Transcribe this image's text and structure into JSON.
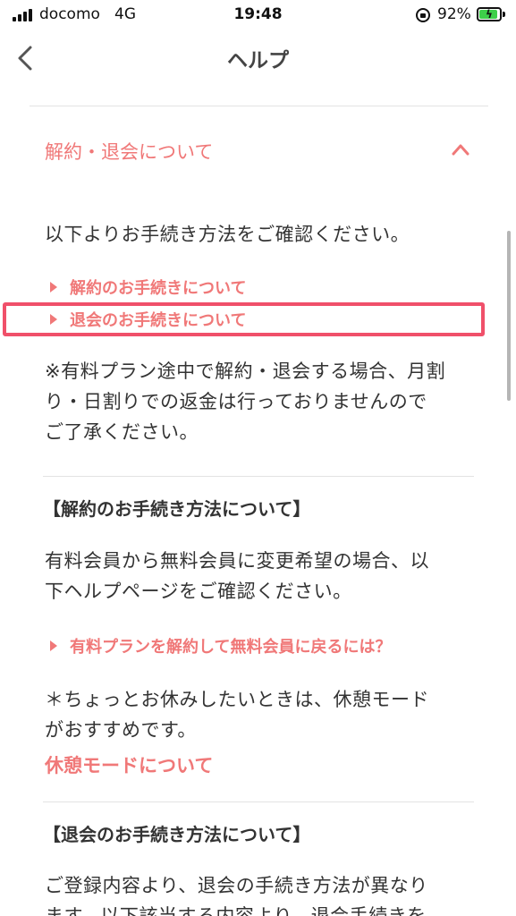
{
  "status_bar": {
    "carrier": "docomo",
    "network": "4G",
    "time": "19:48",
    "battery_percent": "92%",
    "battery_level": 0.92,
    "battery_color": "#3ecf4a"
  },
  "nav": {
    "title": "ヘルプ",
    "back_icon": "chevron-left-icon"
  },
  "accordion": {
    "title": "解約・退会について",
    "expanded": true,
    "toggle_icon": "chevron-up-icon",
    "intro": "以下よりお手続き方法をご確認ください。",
    "links": [
      "解約のお手続きについて",
      "退会のお手続きについて"
    ],
    "note_lines": [
      "※有料プラン途中で解約・退会する場合、月割",
      "り・日割りでの返金は行っておりませんので",
      "ご了承ください。"
    ]
  },
  "cancel_section": {
    "heading": "【解約のお手続き方法について】",
    "body_lines": [
      "有料会員から無料会員に変更希望の場合、以",
      "下ヘルプページをご確認ください。"
    ],
    "link": "有料プランを解約して無料会員に戻るには？",
    "tip_lines": [
      "＊ちょっとお休みしたいときは、休憩モード",
      "がおすすめです。"
    ],
    "rest_link": "休憩モードについて"
  },
  "withdraw_section": {
    "heading": "【退会のお手続き方法について】",
    "body_lines": [
      "ご登録内容より、退会の手続き方法が異なり",
      "ます。以下該当する内容より、退会手続きを"
    ]
  },
  "colors": {
    "accent": "#f07878",
    "highlight": "#f0506a",
    "text": "#333333"
  }
}
